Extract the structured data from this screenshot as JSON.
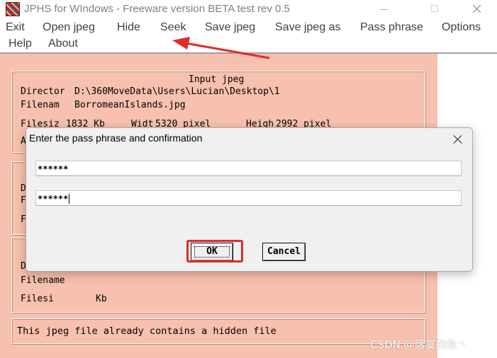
{
  "window": {
    "title": "JPHS for WIndows - Freeware version BETA test rev 0.5",
    "minimize_icon": "minimize-icon",
    "maximize_icon": "maximize-icon",
    "close_icon": "close-icon"
  },
  "menu": {
    "items": [
      "Exit",
      "Open jpeg",
      "Hide",
      "Seek",
      "Save jpeg",
      "Save jpeg as",
      "Pass phrase",
      "Options",
      "Help",
      "About"
    ]
  },
  "input_jpeg": {
    "header": "Input jpeg",
    "directory_label": "Director",
    "directory_value": "D:\\360MoveData\\Users\\Lucian\\Desktop\\1",
    "filename_label": "Filenam",
    "filename_value": "BorromeanIslands.jpg",
    "filesize_label": "Filesiz",
    "filesize_value": "1832 Kb",
    "width_label": "Widt",
    "width_value": "5320 pixel",
    "height_label": "Heigh",
    "height_value": "2992 pixel",
    "row4_label": "A"
  },
  "hidden_file": {
    "row1_label": "D",
    "row2_label": "F",
    "row3_label": "F"
  },
  "saved_jpeg": {
    "directory_label": "D",
    "filename_label": "Filename",
    "filesize_label": "Filesi",
    "filesize_unit": "Kb"
  },
  "status": {
    "message": "This jpeg file already contains a hidden file"
  },
  "dialog": {
    "title": "Enter the pass phrase and confirmation",
    "pass_phrase": "******",
    "confirmation": "******",
    "ok_label": "OK",
    "cancel_label": "Cancel"
  },
  "annotation": {
    "highlight_color": "#e02b2b",
    "arrow_color": "#e02b2b"
  },
  "watermark": "CSDN @落寞的魚丶"
}
